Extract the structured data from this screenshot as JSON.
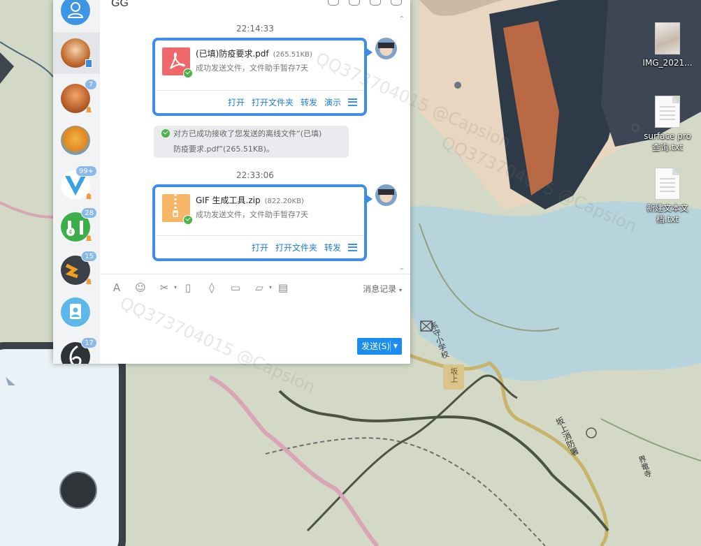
{
  "window": {
    "title": "GG"
  },
  "sidebar": {
    "badges": [
      "7",
      "99+",
      "28",
      "15",
      "17"
    ]
  },
  "messages": {
    "time1": "22:14:33",
    "file1": {
      "name": "(已填)防疫要求.pdf",
      "size": "(265.51KB)",
      "status": "成功发送文件，文件助手暂存7天",
      "actions": [
        "打开",
        "打开文件夹",
        "转发",
        "演示"
      ]
    },
    "system": {
      "line1": "对方已成功接收了您发送的离线文件“(已填)",
      "line2": "防疫要求.pdf”(265.51KB)。"
    },
    "time2": "22:33:06",
    "file2": {
      "name": "GIF 生成工具.zip",
      "size": "(822.20KB)",
      "status": "成功发送文件，文件助手暂存7天",
      "actions": [
        "打开",
        "打开文件夹",
        "转发"
      ]
    }
  },
  "composer": {
    "history_label": "消息记录",
    "send_label": "发送(S)"
  },
  "desktop": {
    "icons": [
      {
        "label": "IMG_2021..."
      },
      {
        "label": "surface pro 查询.txt"
      },
      {
        "label": "新建文本文档.txt"
      }
    ],
    "map_labels": {
      "school": "系守小学校",
      "station": "坂上",
      "road": "坂上消防署",
      "area": "界竜寺"
    }
  },
  "watermark": "QQ373704015 @Capsion"
}
